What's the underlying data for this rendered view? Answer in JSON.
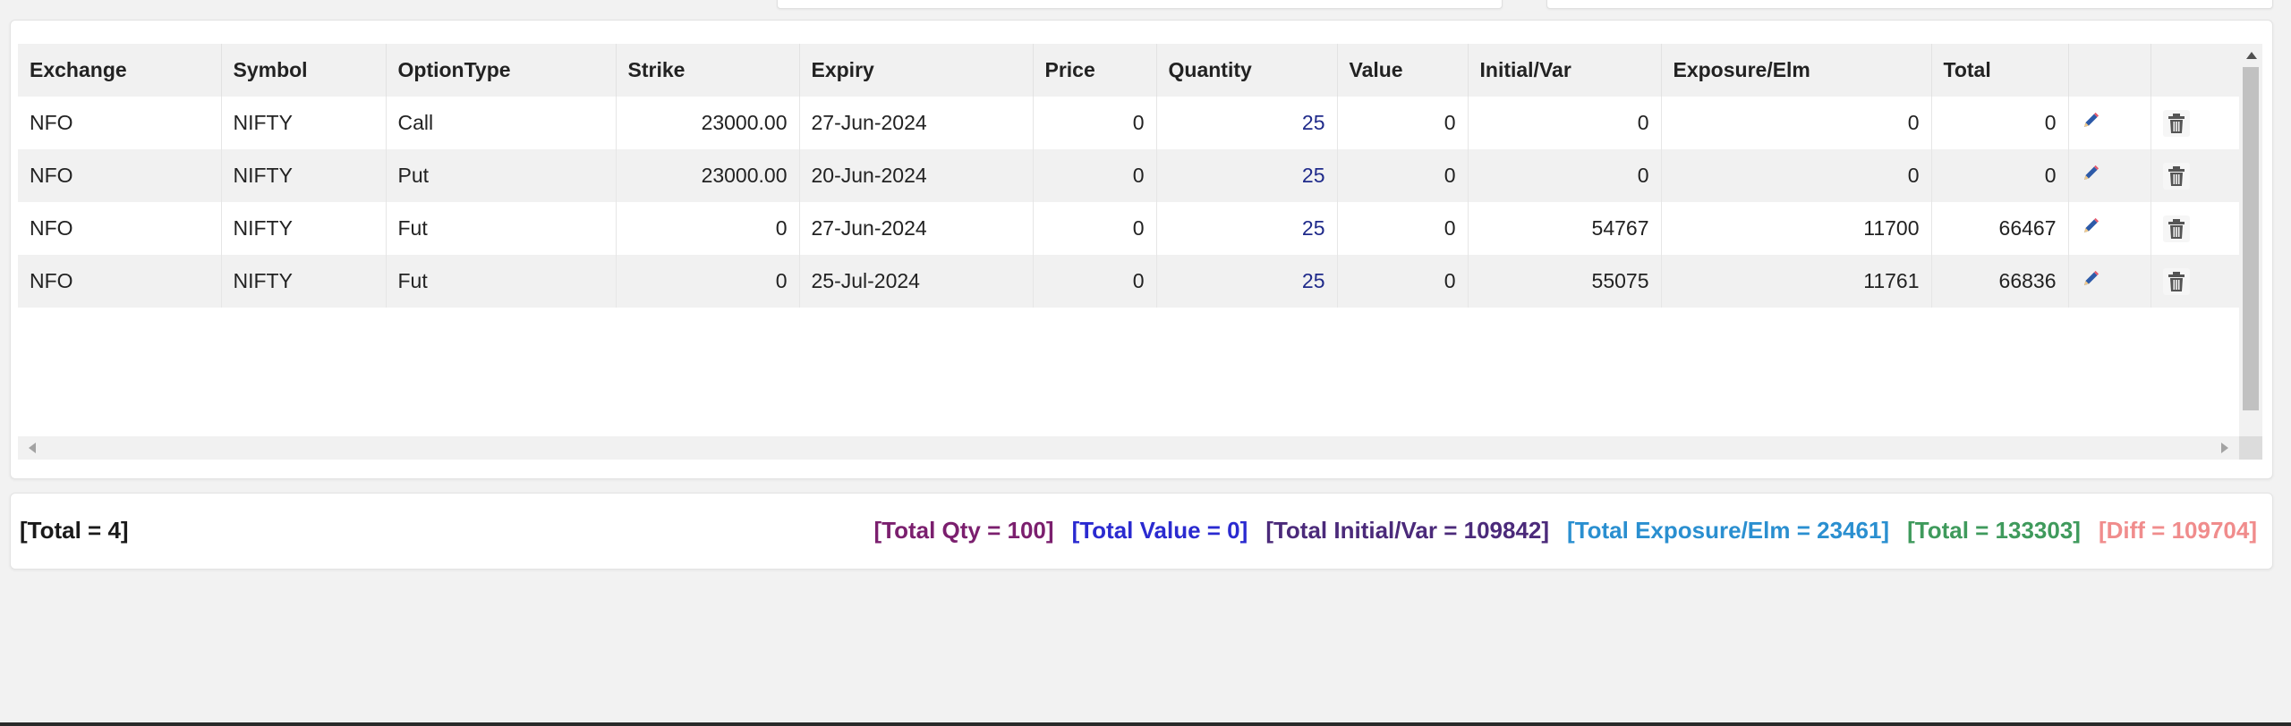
{
  "grid": {
    "headers": [
      "Exchange",
      "Symbol",
      "OptionType",
      "Strike",
      "Expiry",
      "Price",
      "Quantity",
      "Value",
      "Initial/Var",
      "Exposure/Elm",
      "Total",
      "",
      ""
    ],
    "rows": [
      [
        "NFO",
        "NIFTY",
        "Call",
        "23000.00",
        "27-Jun-2024",
        "0",
        "25",
        "0",
        "0",
        "0",
        "0"
      ],
      [
        "NFO",
        "NIFTY",
        "Put",
        "23000.00",
        "20-Jun-2024",
        "0",
        "25",
        "0",
        "0",
        "0",
        "0"
      ],
      [
        "NFO",
        "NIFTY",
        "Fut",
        "0",
        "27-Jun-2024",
        "0",
        "25",
        "0",
        "54767",
        "11700",
        "66467"
      ],
      [
        "NFO",
        "NIFTY",
        "Fut",
        "0",
        "25-Jul-2024",
        "0",
        "25",
        "0",
        "55075",
        "11761",
        "66836"
      ]
    ],
    "row_icons": [
      "pencil-icon",
      "trash-icon"
    ]
  },
  "summary": {
    "count": "[Total = 4]",
    "stats": [
      {
        "text": "[Total Qty = 100]",
        "color": "#7b1f6e"
      },
      {
        "text": "[Total Value = 0]",
        "color": "#2a2ad0"
      },
      {
        "text": "[Total Initial/Var = 109842]",
        "color": "#4b2a7a"
      },
      {
        "text": "[Total Exposure/Elm = 23461]",
        "color": "#2a8fd0"
      },
      {
        "text": "[Total = 133303]",
        "color": "#3f9a5c"
      },
      {
        "text": "[Diff = 109704]",
        "color": "#f08c8c"
      }
    ]
  },
  "colors": {
    "background": "#f2f2f2",
    "header_bg": "#f1f1f1",
    "stripe_bg": "#f1f1f1",
    "quantity_text": "#1f2a8a",
    "pencil_icon": "#2d5aa8"
  }
}
